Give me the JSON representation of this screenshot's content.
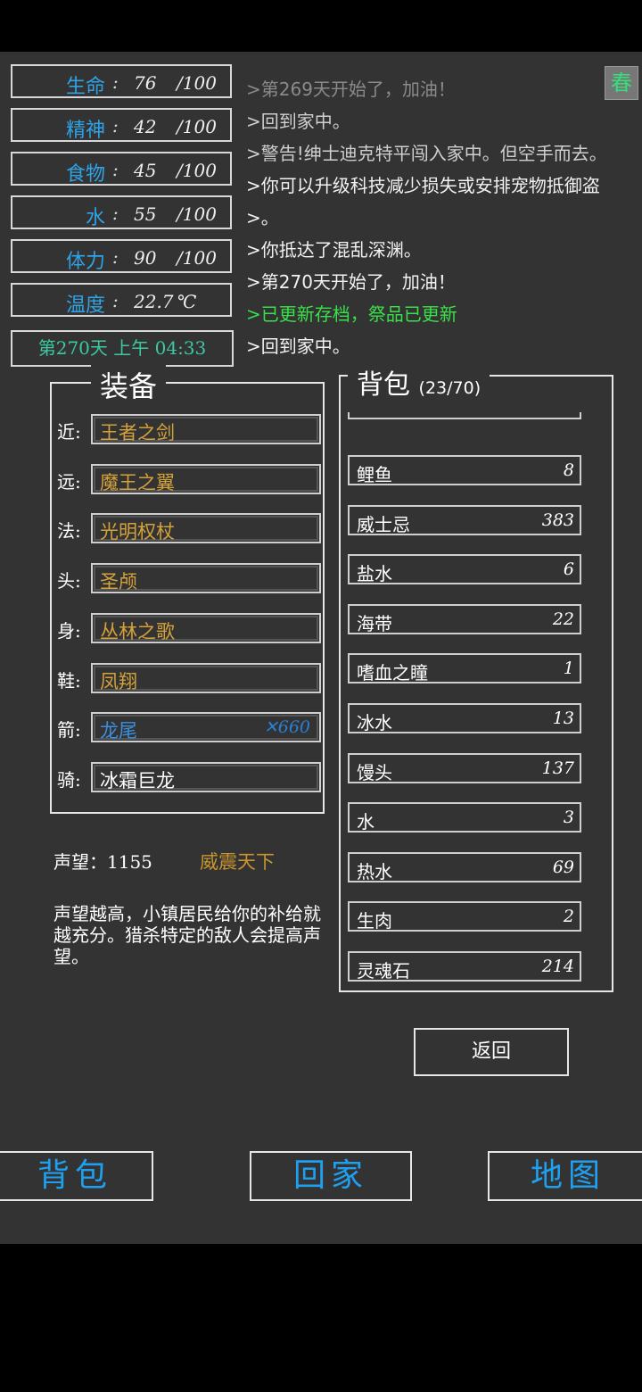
{
  "stats": [
    {
      "label": "生命",
      "value": "76",
      "max": "/100"
    },
    {
      "label": "精神",
      "value": "42",
      "max": "/100"
    },
    {
      "label": "食物",
      "value": "45",
      "max": "/100"
    },
    {
      "label": "水",
      "value": "55",
      "max": "/100"
    },
    {
      "label": "体力",
      "value": "90",
      "max": "/100"
    },
    {
      "label": "温度",
      "value": "22.7",
      "max": "℃"
    }
  ],
  "date": "第270天   上午 04:33",
  "season": "春",
  "log": [
    {
      "text": ">第269天开始了，加油！",
      "color": "#8a8a8a"
    },
    {
      "text": ">回到家中。",
      "color": "#cfcfcf"
    },
    {
      "text": ">警告!绅士迪克特平闯入家中。但空手而去。",
      "color": "#cfcfcf"
    },
    {
      "text": ">你可以升级科技减少损失或安排宠物抵御盗",
      "color": "#f2f2f2"
    },
    {
      "text": ">。",
      "color": "#f2f2f2"
    },
    {
      "text": ">你抵达了混乱深渊。",
      "color": "#f2f2f2"
    },
    {
      "text": ">第270天开始了，加油！",
      "color": "#f2f2f2"
    },
    {
      "text": ">已更新存档，祭品已更新",
      "color": "#39e04a"
    },
    {
      "text": ">回到家中。",
      "color": "#f2f2f2"
    }
  ],
  "equipment": {
    "title": "装备",
    "slots": [
      {
        "key": "近:",
        "value": "王者之剑",
        "color": "#d4a23a"
      },
      {
        "key": "远:",
        "value": "魔王之翼",
        "color": "#d4a23a"
      },
      {
        "key": "法:",
        "value": "光明权杖",
        "color": "#d4a23a"
      },
      {
        "key": "头:",
        "value": "圣颅",
        "color": "#d4a23a"
      },
      {
        "key": "身:",
        "value": "丛林之歌",
        "color": "#d4a23a"
      },
      {
        "key": "鞋:",
        "value": "凤翔",
        "color": "#d4a23a"
      },
      {
        "key": "箭:",
        "value": "龙尾",
        "color": "#3b8fe0",
        "count": "✕660"
      },
      {
        "key": "骑:",
        "value": "冰霜巨龙",
        "color": "#ffffff"
      }
    ]
  },
  "fame": {
    "label": "声望：1155",
    "title": "威震天下",
    "desc": "声望越高，小镇居民给你的补给就越充分。猎杀特定的敌人会提高声望。"
  },
  "bag": {
    "title": "背包",
    "count": "(23/70)",
    "items": [
      {
        "name": "鲤鱼",
        "qty": "8"
      },
      {
        "name": "威士忌",
        "qty": "383"
      },
      {
        "name": "盐水",
        "qty": "6"
      },
      {
        "name": "海带",
        "qty": "22"
      },
      {
        "name": "嗜血之瞳",
        "qty": "1"
      },
      {
        "name": "冰水",
        "qty": "13"
      },
      {
        "name": "馒头",
        "qty": "137"
      },
      {
        "name": "水",
        "qty": "3"
      },
      {
        "name": "热水",
        "qty": "69"
      },
      {
        "name": "生肉",
        "qty": "2"
      },
      {
        "name": "灵魂石",
        "qty": "214"
      }
    ]
  },
  "back_label": "返回",
  "nav": {
    "bag": "背包",
    "home": "回家",
    "map": "地图"
  }
}
